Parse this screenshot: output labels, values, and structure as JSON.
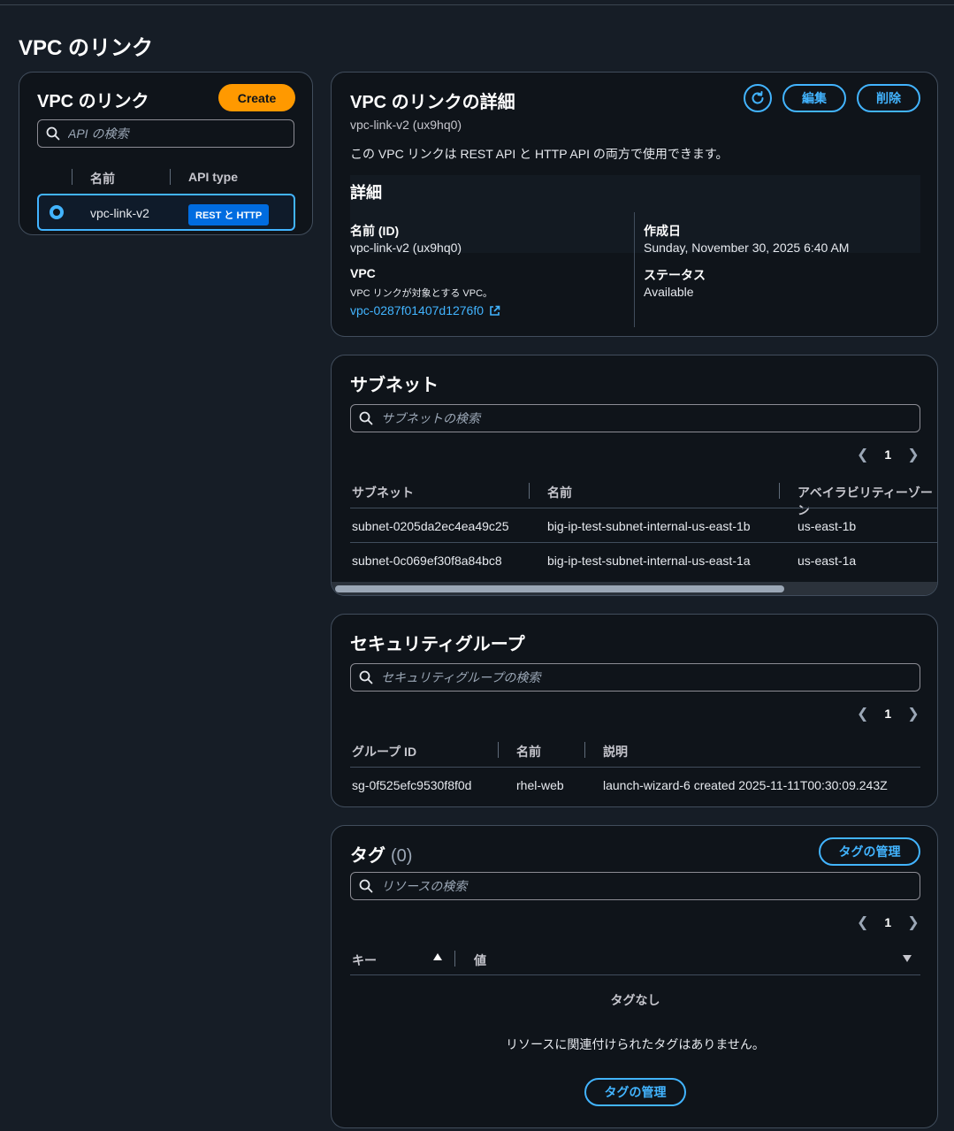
{
  "page_title": "VPC のリンク",
  "list_panel": {
    "title": "VPC のリンク",
    "create_label": "Create",
    "search_placeholder": "API の検索",
    "columns": [
      "名前",
      "API type"
    ],
    "rows": [
      {
        "name": "vpc-link-v2",
        "api_type": "REST と HTTP",
        "selected": true
      }
    ]
  },
  "detail_panel": {
    "title": "VPC のリンクの詳細",
    "subtitle": "vpc-link-v2 (ux9hq0)",
    "description": "この VPC リンクは REST API と HTTP API の両方で使用できます。",
    "edit_label": "編集",
    "delete_label": "削除",
    "section_title": "詳細",
    "name_label": "名前 (ID)",
    "name_value": "vpc-link-v2 (ux9hq0)",
    "vpc_label": "VPC",
    "vpc_desc": "VPC リンクが対象とする VPC。",
    "vpc_link": "vpc-0287f01407d1276f0",
    "created_label": "作成日",
    "created_value": "Sunday, November 30, 2025 6:40 AM",
    "status_label": "ステータス",
    "status_value": "Available"
  },
  "subnets": {
    "title": "サブネット",
    "search_placeholder": "サブネットの検索",
    "page": "1",
    "columns": [
      "サブネット",
      "名前",
      "アベイラビリティーゾーン"
    ],
    "rows": [
      {
        "id": "subnet-0205da2ec4ea49c25",
        "name": "big-ip-test-subnet-internal-us-east-1b",
        "az": "us-east-1b"
      },
      {
        "id": "subnet-0c069ef30f8a84bc8",
        "name": "big-ip-test-subnet-internal-us-east-1a",
        "az": "us-east-1a"
      }
    ]
  },
  "security_groups": {
    "title": "セキュリティグループ",
    "search_placeholder": "セキュリティグループの検索",
    "page": "1",
    "columns": [
      "グループ ID",
      "名前",
      "説明"
    ],
    "rows": [
      {
        "id": "sg-0f525efc9530f8f0d",
        "name": "rhel-web",
        "desc": "launch-wizard-6 created 2025-11-11T00:30:09.243Z"
      }
    ]
  },
  "tags": {
    "title": "タグ",
    "count": "(0)",
    "manage_label": "タグの管理",
    "search_placeholder": "リソースの検索",
    "page": "1",
    "columns": [
      "キー",
      "値"
    ],
    "empty_title": "タグなし",
    "empty_desc": "リソースに関連付けられたタグはありません。",
    "empty_button": "タグの管理"
  },
  "colors": {
    "background": "#161d26",
    "panel": "#0f141a",
    "accent_orange": "#ff9900",
    "link_blue": "#42b4ff",
    "badge_blue": "#006ce0"
  }
}
